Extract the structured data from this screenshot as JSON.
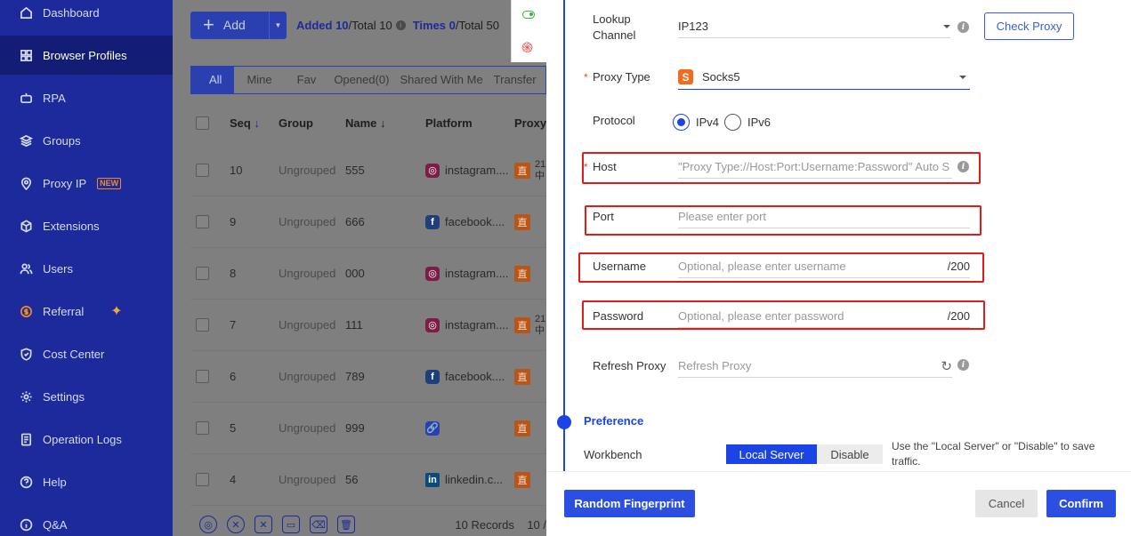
{
  "sidebar": {
    "items": [
      {
        "label": "Dashboard",
        "icon": "home-icon"
      },
      {
        "label": "Browser Profiles",
        "icon": "grid-icon",
        "active": true
      },
      {
        "label": "RPA",
        "icon": "robot-icon"
      },
      {
        "label": "Groups",
        "icon": "layers-icon"
      },
      {
        "label": "Proxy IP",
        "icon": "location-icon",
        "badge": "NEW"
      },
      {
        "label": "Extensions",
        "icon": "cube-icon"
      },
      {
        "label": "Users",
        "icon": "users-icon"
      },
      {
        "label": "Referral",
        "icon": "coin-icon"
      },
      {
        "label": "Cost Center",
        "icon": "shield-icon"
      },
      {
        "label": "Settings",
        "icon": "gear-icon"
      },
      {
        "label": "Operation Logs",
        "icon": "document-icon"
      },
      {
        "label": "Help",
        "icon": "question-icon"
      },
      {
        "label": "Q&A",
        "icon": "info-icon"
      }
    ]
  },
  "toolbar": {
    "add_label": "Add",
    "added_prefix": "Added ",
    "added_count": "10",
    "added_total": "/Total 10",
    "times_prefix": "Times ",
    "times_count": "0",
    "times_total": "/Total 50"
  },
  "tabs": [
    "All",
    "Mine",
    "Fav",
    "Opened(0)",
    "Shared With Me",
    "Transfer"
  ],
  "table": {
    "headers": {
      "seq": "Seq",
      "group": "Group",
      "name": "Name",
      "platform": "Platform",
      "proxy": "Proxy"
    },
    "rows": [
      {
        "seq": "10",
        "group": "Ungrouped",
        "name": "555",
        "platform": "instagram....",
        "platform_icon": "instagram-icon",
        "proxy_tag": "直",
        "proxy_sub1": "21",
        "proxy_sub2": "中"
      },
      {
        "seq": "9",
        "group": "Ungrouped",
        "name": "666",
        "platform": "facebook....",
        "platform_icon": "facebook-icon",
        "proxy_tag": "直",
        "proxy_sub1": "",
        "proxy_sub2": ""
      },
      {
        "seq": "8",
        "group": "Ungrouped",
        "name": "000",
        "platform": "instagram....",
        "platform_icon": "instagram-icon",
        "proxy_tag": "直",
        "proxy_sub1": "",
        "proxy_sub2": ""
      },
      {
        "seq": "7",
        "group": "Ungrouped",
        "name": "111",
        "platform": "instagram....",
        "platform_icon": "instagram-icon",
        "proxy_tag": "直",
        "proxy_sub1": "21",
        "proxy_sub2": "中"
      },
      {
        "seq": "6",
        "group": "Ungrouped",
        "name": "789",
        "platform": "facebook....",
        "platform_icon": "facebook-icon",
        "proxy_tag": "直",
        "proxy_sub1": "",
        "proxy_sub2": ""
      },
      {
        "seq": "5",
        "group": "Ungrouped",
        "name": "999",
        "platform": "",
        "platform_icon": "link-icon",
        "proxy_tag": "直",
        "proxy_sub1": "",
        "proxy_sub2": ""
      },
      {
        "seq": "4",
        "group": "Ungrouped",
        "name": "56",
        "platform": "linkedin.c...",
        "platform_icon": "linkedin-icon",
        "proxy_tag": "直",
        "proxy_sub1": "",
        "proxy_sub2": ""
      }
    ]
  },
  "footer": {
    "records": "10 Records",
    "page": "10 /"
  },
  "drawer": {
    "lookup_label_1": "Lookup",
    "lookup_label_2": "Channel",
    "lookup_value": "IP123",
    "check_proxy": "Check Proxy",
    "proxy_type_label": "Proxy Type",
    "proxy_type_icon_letter": "S",
    "proxy_type_value": "Socks5",
    "protocol_label": "Protocol",
    "ipv4": "IPv4",
    "ipv6": "IPv6",
    "host_label": "Host",
    "host_placeholder": "\"Proxy Type://Host:Port:Username:Password\" Auto Sp",
    "port_label": "Port",
    "port_placeholder": "Please enter port",
    "username_label": "Username",
    "username_placeholder": "Optional, please enter username",
    "username_limit": "/200",
    "password_label": "Password",
    "password_placeholder": "Optional, please enter password",
    "password_limit": "/200",
    "refresh_label": "Refresh Proxy",
    "refresh_placeholder": "Refresh Proxy",
    "preference_title": "Preference",
    "workbench_label": "Workbench",
    "workbench_on": "Local Server",
    "workbench_off": "Disable",
    "workbench_note": "Use the \"Local Server\" or \"Disable\" to save traffic.",
    "random_fp": "Random Fingerprint",
    "cancel": "Cancel",
    "confirm": "Confirm"
  },
  "colors": {
    "sidebar": "#1c2a9c",
    "accent": "#2b4fe0",
    "highlight_box": "#e3191b",
    "proxy_tag": "#f26b1d"
  }
}
